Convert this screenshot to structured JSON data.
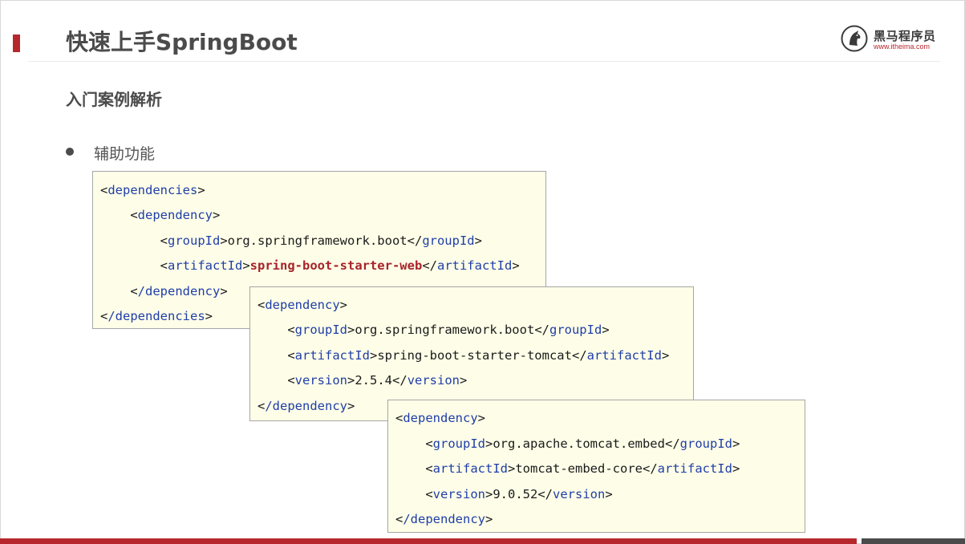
{
  "slide": {
    "title": "快速上手SpringBoot",
    "subtitle": "入门案例解析",
    "bullet": "辅助功能",
    "accent_color": "#b7282e"
  },
  "logo": {
    "icon": "horse-head-icon",
    "name": "黑马程序员",
    "url": "www.itheima.com"
  },
  "code_blocks": [
    {
      "lines": [
        {
          "indent": "",
          "open": "dependencies",
          "close": ""
        },
        {
          "indent": "    ",
          "open": "dependency",
          "close": ""
        },
        {
          "indent": "        ",
          "open": "groupId",
          "value": "org.springframework.boot",
          "close": "groupId"
        },
        {
          "indent": "        ",
          "open": "artifactId",
          "value": "spring-boot-starter-web",
          "close": "artifactId",
          "emphasis": true
        },
        {
          "indent": "    ",
          "open": "/dependency",
          "close": ""
        },
        {
          "indent": "",
          "open": "/dependencies",
          "close": ""
        }
      ]
    },
    {
      "lines": [
        {
          "indent": "",
          "open": "dependency",
          "close": ""
        },
        {
          "indent": "    ",
          "open": "groupId",
          "value": "org.springframework.boot",
          "close": "groupId"
        },
        {
          "indent": "    ",
          "open": "artifactId",
          "value": "spring-boot-starter-tomcat",
          "close": "artifactId"
        },
        {
          "indent": "    ",
          "open": "version",
          "value": "2.5.4",
          "close": "version"
        },
        {
          "indent": "",
          "open": "/dependency",
          "close": ""
        }
      ]
    },
    {
      "lines": [
        {
          "indent": "",
          "open": "dependency",
          "close": ""
        },
        {
          "indent": "    ",
          "open": "groupId",
          "value": "org.apache.tomcat.embed",
          "close": "groupId"
        },
        {
          "indent": "    ",
          "open": "artifactId",
          "value": "tomcat-embed-core",
          "close": "artifactId"
        },
        {
          "indent": "    ",
          "open": "version",
          "value": "9.0.52",
          "close": "version"
        },
        {
          "indent": "",
          "open": "/dependency",
          "close": ""
        }
      ]
    }
  ]
}
